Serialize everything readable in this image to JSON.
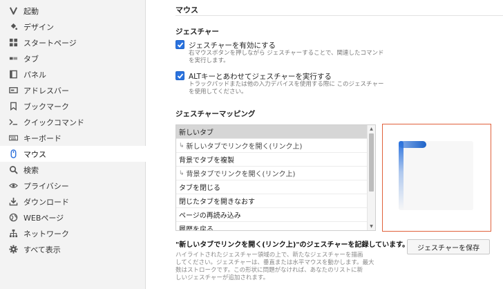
{
  "sidebar": {
    "items": [
      {
        "label": "起動",
        "icon": "vivaldi-icon"
      },
      {
        "label": "デザイン",
        "icon": "paint-bucket-icon"
      },
      {
        "label": "スタートページ",
        "icon": "grid-icon"
      },
      {
        "label": "タブ",
        "icon": "tab-icon"
      },
      {
        "label": "パネル",
        "icon": "panel-icon"
      },
      {
        "label": "アドレスバー",
        "icon": "address-bar-icon"
      },
      {
        "label": "ブックマーク",
        "icon": "bookmark-icon"
      },
      {
        "label": "クイックコマンド",
        "icon": "quick-command-icon"
      },
      {
        "label": "キーボード",
        "icon": "keyboard-icon"
      },
      {
        "label": "マウス",
        "icon": "mouse-icon"
      },
      {
        "label": "検索",
        "icon": "search-icon"
      },
      {
        "label": "プライバシー",
        "icon": "eye-icon"
      },
      {
        "label": "ダウンロード",
        "icon": "download-icon"
      },
      {
        "label": "WEBページ",
        "icon": "globe-icon"
      },
      {
        "label": "ネットワーク",
        "icon": "network-icon"
      },
      {
        "label": "すべて表示",
        "icon": "gear-icon"
      }
    ],
    "active_index": 9
  },
  "main": {
    "title": "マウス",
    "gestures_section": "ジェスチャー",
    "enable_gestures": {
      "label": "ジェスチャーを有効にする",
      "desc_1": "右マウスボタンを押しながら ジェスチャーすることで、関連したコマンド",
      "desc_2": "を実行します。",
      "checked": true
    },
    "alt_gestures": {
      "label": "ALTキーとあわせてジェスチャーを実行する",
      "desc_1": "トラックパッドまたは他の入力デバイスを使用する際に このジェスチャー",
      "desc_2": "を使用してください。",
      "checked": true
    },
    "mapping_section": "ジェスチャーマッピング",
    "mapping_list": [
      {
        "label": "新しいタブ",
        "sub": false
      },
      {
        "label": "新しいタブでリンクを開く(リンク上)",
        "sub": true
      },
      {
        "label": "背景でタブを複製",
        "sub": false
      },
      {
        "label": "背景タブでリンクを開く(リンク上)",
        "sub": true
      },
      {
        "label": "タブを閉じる",
        "sub": false
      },
      {
        "label": "閉じたタブを開きなおす",
        "sub": false
      },
      {
        "label": "ページの再読み込み",
        "sub": false
      },
      {
        "label": "履歴を戻る",
        "sub": false
      }
    ],
    "selected_index": 0,
    "record_text": "\"新しいタブでリンクを開く(リンク上)\"のジェスチャーを記録しています。",
    "save_button": "ジェスチャーを保存",
    "help_1": "ハイライトされたジェスチャー領域の上で、新たなジェスチャーを描画",
    "help_2": "してください。ジェスチャーは、垂直または水平マウスを動かします。最大",
    "help_3": "数はストロークです。この形状に問題がなければ、あなたのリストに新",
    "help_4": "しいジェスチャーが追加されます。"
  },
  "colors": {
    "accent": "#2a72de",
    "gesture_border": "#e0603a"
  }
}
